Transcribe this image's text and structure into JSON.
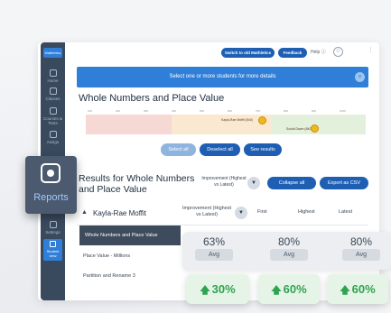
{
  "sidebar": {
    "logo": "Mathletics",
    "items": [
      {
        "label": "Home"
      },
      {
        "label": "Classes"
      },
      {
        "label": "Courses & Tests"
      },
      {
        "label": "Assign"
      },
      {
        "label": "Settings"
      }
    ],
    "student_view": "Student view"
  },
  "topbar": {
    "switch_label": "Switch to old Mathletics",
    "feedback_label": "Feedback",
    "help_label": "Help"
  },
  "banner": {
    "text": "Select one or more students for more details"
  },
  "page": {
    "title": "Whole Numbers and Place Value"
  },
  "range": {
    "ticks": [
      "100",
      "200",
      "300",
      "400",
      "500",
      "600",
      "700",
      "800",
      "900",
      "1000"
    ],
    "marker1": "Kayla-Rae Moffit (540)",
    "marker2": "Social Dawn (840)"
  },
  "actions": {
    "select_all": "Select all",
    "deselect_all": "Deselect all",
    "see_results": "See results"
  },
  "results": {
    "title": "Results for Whole Numbers and Place Value",
    "improvement_label": "Improvement (Highest vs Latest)",
    "collapse_all": "Collapse all",
    "export_csv": "Export as CSV"
  },
  "table": {
    "student": "Kayla-Rae Moffit",
    "col_improvement": "Improvement (Highest vs Latest)",
    "col_first": "First",
    "col_highest": "Highest",
    "col_latest": "Latest",
    "rows": [
      "Whole Numbers and Place Value",
      "Place Value - Millions",
      "Partition and Rename 3"
    ]
  },
  "reports": {
    "label": "Reports"
  },
  "averages": [
    {
      "value": "63%",
      "label": "Avg"
    },
    {
      "value": "80%",
      "label": "Avg"
    },
    {
      "value": "80%",
      "label": "Avg"
    }
  ],
  "gains": [
    "30%",
    "60%",
    "60%"
  ],
  "colors": {
    "accent": "#2f7fd8",
    "brand": "#1e5fb4",
    "positive": "#2fa44f",
    "sidebar": "#3a4a5e"
  }
}
